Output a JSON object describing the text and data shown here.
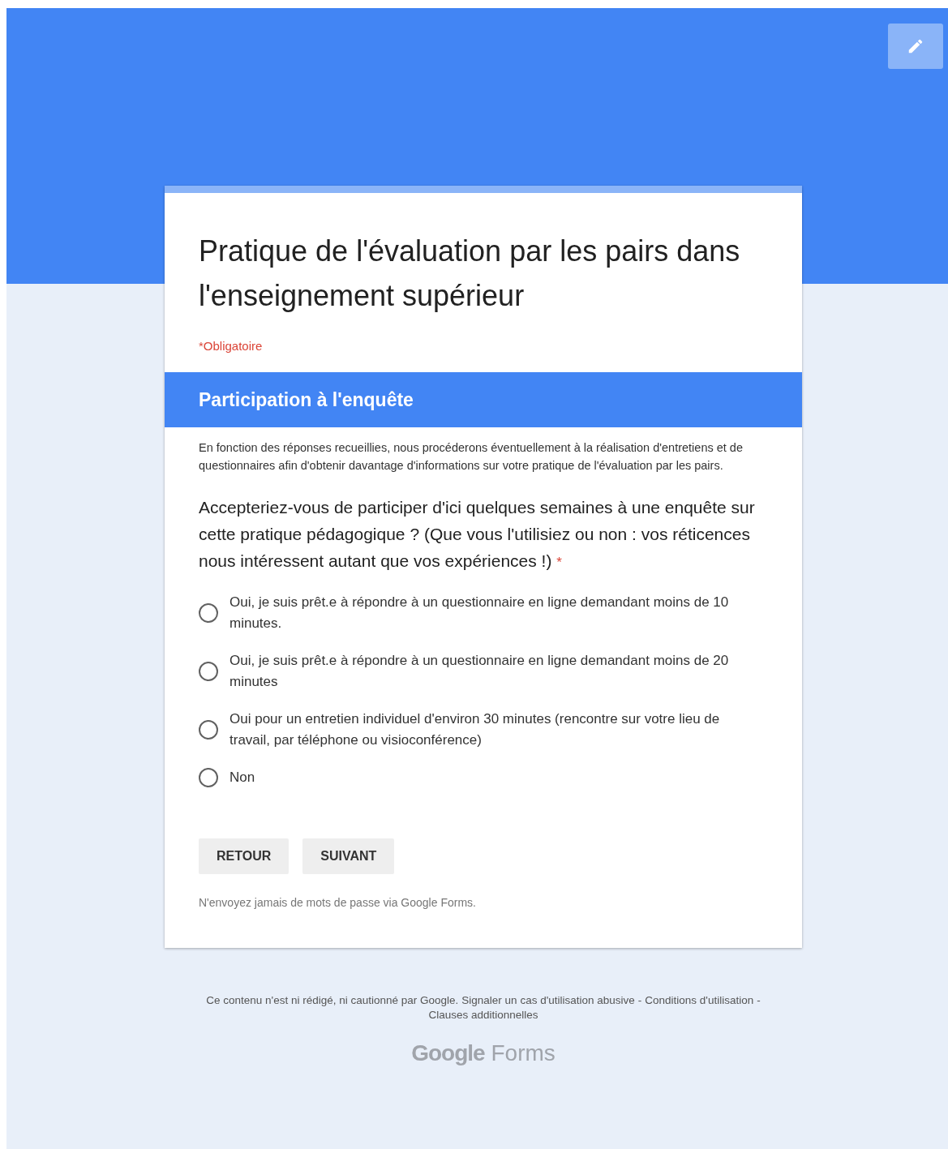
{
  "form": {
    "title": "Pratique de l'évaluation par les pairs dans l'enseignement supérieur",
    "required_note": "*Obligatoire"
  },
  "section": {
    "title": "Participation à l'enquête",
    "description": "En fonction des réponses recueillies, nous procéderons éventuellement à la réalisation d'entretiens et de questionnaires afin d'obtenir davantage d'informations sur votre pratique de l'évaluation par les pairs."
  },
  "question": {
    "text": "Accepteriez-vous de participer d'ici quelques semaines à une enquête sur cette pratique pédagogique ? (Que vous l'utilisiez ou non : vos réticences nous intéressent autant que vos expériences !)",
    "required_mark": "*",
    "options": [
      {
        "label": "Oui, je suis prêt.e à répondre à un questionnaire en ligne demandant moins de 10 minutes.",
        "selected": false
      },
      {
        "label": "Oui, je suis prêt.e à répondre à un questionnaire en ligne demandant moins de 20 minutes",
        "selected": false
      },
      {
        "label": "Oui pour un entretien individuel d'environ 30 minutes (rencontre sur votre lieu de travail, par téléphone ou visioconférence)",
        "selected": false
      },
      {
        "label": "Non",
        "selected": false
      }
    ]
  },
  "buttons": [
    "RETOUR",
    "SUIVANT"
  ],
  "password_notice": "N'envoyez jamais de mots de passe via Google Forms.",
  "footer": {
    "disclaimer": "Ce contenu n'est ni rédigé, ni cautionné par Google.",
    "links": [
      {
        "text": "Signaler un cas d'utilisation abusive"
      },
      {
        "text": "Conditions d'utilisation",
        "separator": "-"
      },
      {
        "text": "Clauses additionnelles",
        "separator": "-"
      }
    ],
    "logo": [
      "Google",
      "Forms"
    ]
  }
}
